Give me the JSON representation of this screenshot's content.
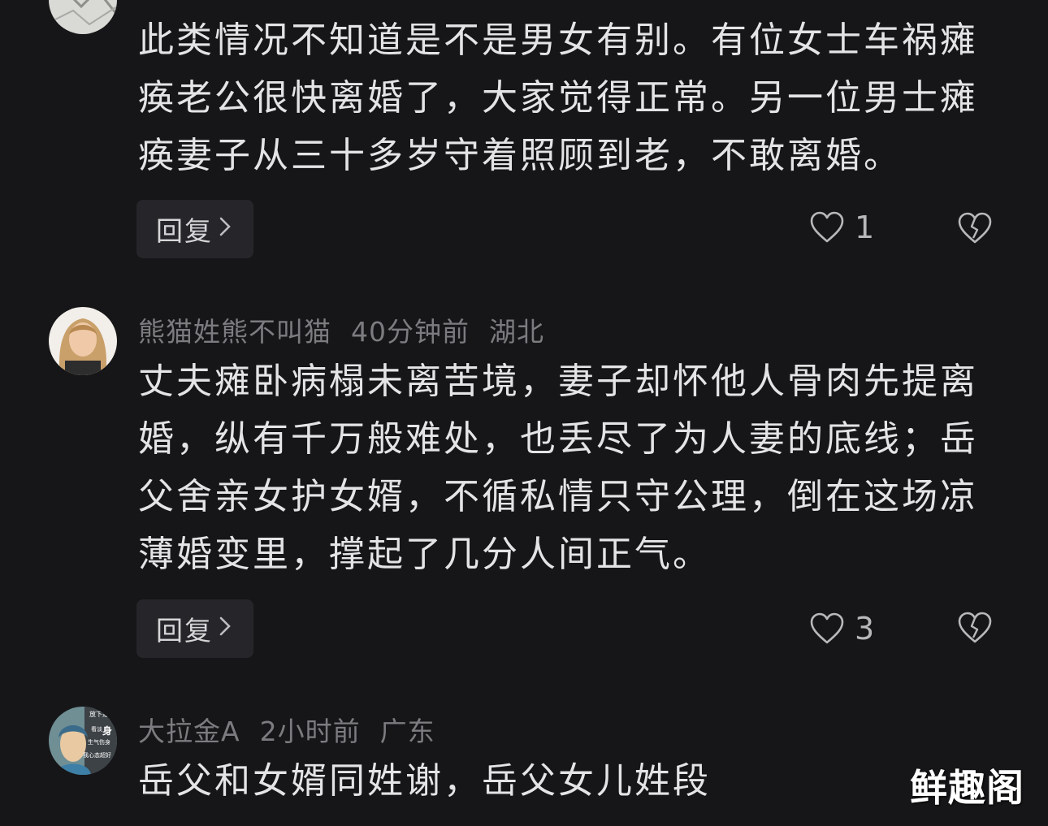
{
  "comments": [
    {
      "user": "",
      "time": "",
      "region": "",
      "lines": [
        "此类情况不知道是不是男女有别。有位女士车祸瘫",
        "痪老公很快离婚了，大家觉得正常。另一位男士瘫",
        "痪妻子从三十多岁守着照顾到老，不敢离婚。"
      ],
      "reply_label": "回复",
      "likes": "1"
    },
    {
      "user": "熊猫姓熊不叫猫",
      "time": "40分钟前",
      "region": "湖北",
      "lines": [
        "丈夫瘫卧病榻未离苦境，妻子却怀他人骨肉先提离",
        "婚，纵有千万般难处，也丢尽了为人妻的底线；岳",
        "父舍亲女护女婿，不循私情只守公理，倒在这场凉",
        "薄婚变里，撑起了几分人间正气。"
      ],
      "reply_label": "回复",
      "likes": "3"
    },
    {
      "user": "大拉金A",
      "time": "2小时前",
      "region": "广东",
      "lines": [
        "岳父和女婿同姓谢，岳父女儿姓段"
      ]
    }
  ],
  "avatar_text": [
    "放下是",
    "看淡",
    "身",
    "生气伤身",
    "我心态超好"
  ],
  "watermark": "鲜趣阁",
  "icons": {
    "like": "heart-icon",
    "dislike": "broken-heart-icon",
    "chevron": "chevron-right-icon"
  },
  "colors": {
    "background": "#161618",
    "text": "#e4e4e6",
    "meta": "#7c7c80",
    "button_bg": "#26262a"
  }
}
